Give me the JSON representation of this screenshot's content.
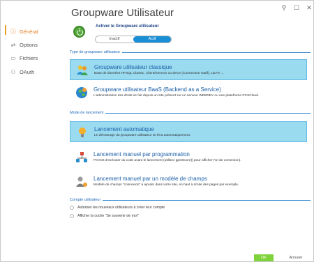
{
  "window": {
    "title": "Groupware Utilisateur"
  },
  "sidebar": {
    "items": [
      {
        "label": "Général",
        "icon": "info-icon",
        "active": true
      },
      {
        "label": "Options",
        "icon": "options-icon",
        "active": false
      },
      {
        "label": "Fichiers",
        "icon": "files-icon",
        "active": false
      },
      {
        "label": "OAuth",
        "icon": "oauth-icon",
        "active": false
      }
    ]
  },
  "activation": {
    "label": "Activer le Groupware utilisateur",
    "off_label": "Inactif",
    "on_label": "Actif",
    "state": "Actif"
  },
  "sections": {
    "type": "Type de groupware utilisateur",
    "mode": "Mode de lancement",
    "account": "Compte utilisateur"
  },
  "type_options": [
    {
      "title": "Groupware utilisateur classique",
      "desc": "Base de données HFSQL Classic, Client/Serveur ou tierce (Connecteur Natif), LDAP, ...",
      "selected": true
    },
    {
      "title": "Groupware utilisateur BaaS (Backend as a Service)",
      "desc": "L'administration des droits se fait depuis un site présent sur un serveur WEBDEV ou une plateforme PCSCloud.",
      "selected": false
    }
  ],
  "mode_options": [
    {
      "title": "Lancement automatique",
      "desc": "Le démarrage du groupware utilisateur se fera automatiquement.",
      "selected": true
    },
    {
      "title": "Lancement manuel par programmation",
      "desc": "Permet d'exécuter du code avant le lancement (utilisez gpwOuvre() pour afficher l'UI de connexion).",
      "selected": false
    },
    {
      "title": "Lancement manuel par un modèle de champs",
      "desc": "Modèle de champs \"connexion\" à ajouter dans votre site, en haut à droite des pages par exemple.",
      "selected": false
    }
  ],
  "account_options": [
    {
      "label": "Autoriser les nouveaux utilisateurs à créer leur compte",
      "checked": false
    },
    {
      "label": "Afficher la coche \"Se souvenir de moi\"",
      "checked": false
    }
  ],
  "footer": {
    "ok": "OK",
    "cancel": "Annuler"
  },
  "colors": {
    "accent": "#1a8fd6",
    "selected_bg": "#9adbf0",
    "ok_button": "#7fd33a",
    "active_nav": "#e07a1b"
  }
}
